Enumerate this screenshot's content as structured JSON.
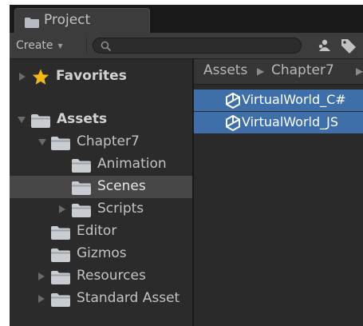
{
  "tab": {
    "label": "Project"
  },
  "toolbar": {
    "create_label": "Create",
    "search_placeholder": ""
  },
  "tree": {
    "favorites": "Favorites",
    "assets": "Assets",
    "items": [
      {
        "label": "Chapter7",
        "expanded": true
      },
      {
        "label": "Animation"
      },
      {
        "label": "Scenes",
        "selected": true
      },
      {
        "label": "Scripts",
        "expanded": false
      },
      {
        "label": "Editor"
      },
      {
        "label": "Gizmos"
      },
      {
        "label": "Resources",
        "expanded": false
      },
      {
        "label": "Standard Asset",
        "expanded": false
      }
    ]
  },
  "breadcrumb": [
    "Assets",
    "Chapter7"
  ],
  "files": [
    {
      "label": "VirtualWorld_C#",
      "icon": "unity-icon"
    },
    {
      "label": "VirtualWorld_JS",
      "icon": "unity-icon"
    }
  ],
  "colors": {
    "selection": "#3f6fa8",
    "folder": "#c9cdd2",
    "star": "#f2b816"
  }
}
